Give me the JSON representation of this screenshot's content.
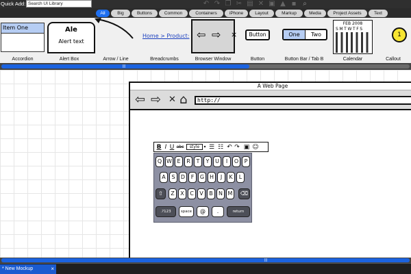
{
  "toolbar": {
    "quick_add_label": "Quick Add:",
    "search_placeholder": "Search UI Library",
    "icons": [
      "undo-icon",
      "redo-icon",
      "copy-icon",
      "cut-icon",
      "paste-icon",
      "delete-icon",
      "group-icon",
      "bring-front-icon",
      "lock-icon",
      "zoom-icon"
    ]
  },
  "categories": {
    "active": "All",
    "items": [
      "All",
      "Big",
      "Buttons",
      "Common",
      "Containers",
      "iPhone",
      "Layout",
      "Markup",
      "Media",
      "Project Assets",
      "Text"
    ]
  },
  "library": {
    "accordion": {
      "label": "Accordion",
      "item": "Item One"
    },
    "alert_box": {
      "label": "Alert Box",
      "title": "Ale",
      "text": "Alert text"
    },
    "arrow_line": {
      "label": "Arrow / Line"
    },
    "breadcrumbs": {
      "label": "Breadcrumbs",
      "text": "Home > Product:"
    },
    "browser_window": {
      "label": "Browser Window"
    },
    "button": {
      "label": "Button",
      "text": "Button"
    },
    "button_bar": {
      "label": "Button Bar / Tab B",
      "one": "One",
      "two": "Two"
    },
    "calendar": {
      "label": "Calendar",
      "month": "FEB 2008",
      "days": "SMTWTFS"
    },
    "callout": {
      "label": "Callout",
      "number": "1"
    }
  },
  "canvas": {
    "browser": {
      "title": "A Web Page",
      "url": "http://"
    },
    "rich_text_toolbar": {
      "bold": "B",
      "italic": "I",
      "underline": "U",
      "strike": "abc",
      "style": "style"
    },
    "keyboard": {
      "row1": [
        "Q",
        "W",
        "E",
        "R",
        "T",
        "Y",
        "U",
        "I",
        "O",
        "P"
      ],
      "row2": [
        "A",
        "S",
        "D",
        "F",
        "G",
        "H",
        "J",
        "K",
        "L"
      ],
      "row3": [
        "Z",
        "X",
        "C",
        "V",
        "B",
        "N",
        "M"
      ],
      "row4": [
        ".?123",
        "space",
        "@",
        ".",
        "return"
      ]
    }
  },
  "bottom_tab": {
    "label": "* New Mockup",
    "close": "×"
  },
  "colors": {
    "accent_blue": "#1e6ff0",
    "keyboard_bg": "#8d90a3"
  }
}
